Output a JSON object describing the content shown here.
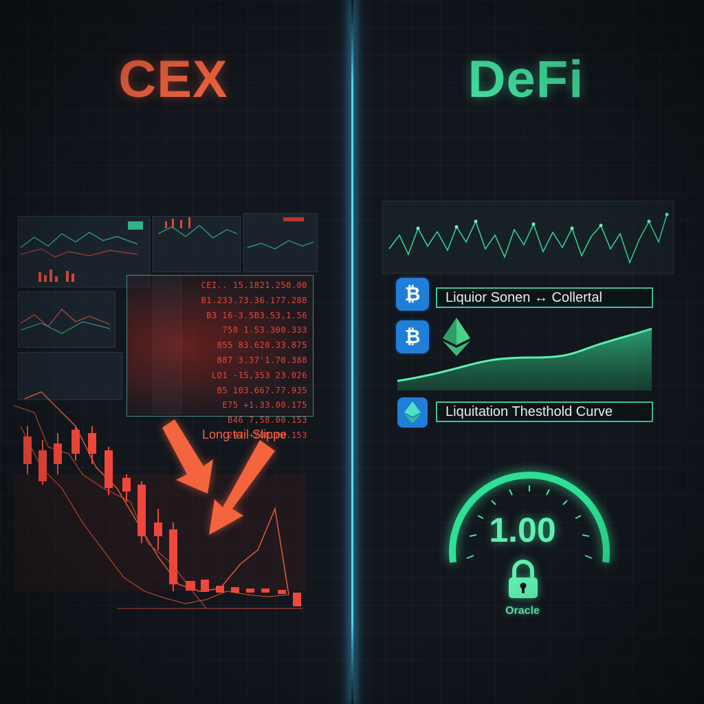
{
  "left": {
    "title": "CEX",
    "order_book": [
      "CEI.. 15.1821.250.00",
      "B1.233.73.36.177.288",
      "B3 16-3.5B3.53,1.56",
      "758   1.53.300.333",
      "855   83.620.33.875",
      "887   3.37'1.70.388",
      "LO1 -15,353 23.026",
      "B5  103.667.77.935",
      "E75   +1.33.00.175",
      "B46    7,58.00.153",
      "297   +208.00.153"
    ],
    "slippage_label": "Long tail Slippe",
    "colors": {
      "accent": "#f4643f",
      "candle": "#e8453a"
    }
  },
  "right": {
    "title": "DeFi",
    "label_collateral": "Liquior Sonen ↔ Collertal",
    "label_threshold": "Liquitation Thesthold Curve",
    "gauge_value": "1.00",
    "oracle_label": "Oracle",
    "icons": [
      "bitcoin-icon",
      "bitcoin-icon",
      "ethereum-icon",
      "ethereum-icon",
      "lock-icon"
    ],
    "colors": {
      "accent": "#43e0a0",
      "coin": "#1f7fd8"
    }
  },
  "divider_color": "#4fd7ff"
}
